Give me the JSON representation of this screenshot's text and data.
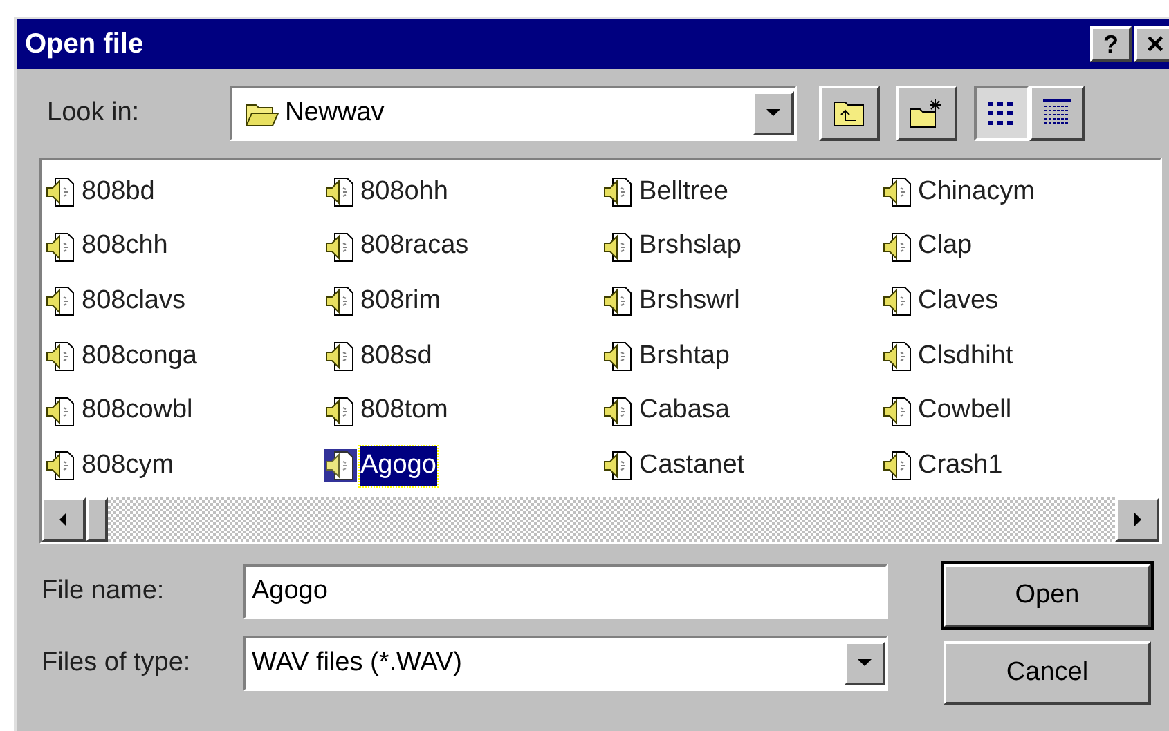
{
  "window": {
    "title": "Open file",
    "help_button": "?",
    "close_button": "×"
  },
  "look_in": {
    "label": "Look in:",
    "value": "Newwav"
  },
  "files": [
    {
      "name": "808bd",
      "selected": false
    },
    {
      "name": "808chh",
      "selected": false
    },
    {
      "name": "808clavs",
      "selected": false
    },
    {
      "name": "808conga",
      "selected": false
    },
    {
      "name": "808cowbl",
      "selected": false
    },
    {
      "name": "808cym",
      "selected": false
    },
    {
      "name": "808ohh",
      "selected": false
    },
    {
      "name": "808racas",
      "selected": false
    },
    {
      "name": "808rim",
      "selected": false
    },
    {
      "name": "808sd",
      "selected": false
    },
    {
      "name": "808tom",
      "selected": false
    },
    {
      "name": "Agogo",
      "selected": true
    },
    {
      "name": "Belltree",
      "selected": false
    },
    {
      "name": "Brshslap",
      "selected": false
    },
    {
      "name": "Brshswrl",
      "selected": false
    },
    {
      "name": "Brshtap",
      "selected": false
    },
    {
      "name": "Cabasa",
      "selected": false
    },
    {
      "name": "Castanet",
      "selected": false
    },
    {
      "name": "Chinacym",
      "selected": false
    },
    {
      "name": "Clap",
      "selected": false
    },
    {
      "name": "Claves",
      "selected": false
    },
    {
      "name": "Clsdhiht",
      "selected": false
    },
    {
      "name": "Cowbell",
      "selected": false
    },
    {
      "name": "Crash1",
      "selected": false
    }
  ],
  "file_name": {
    "label": "File name:",
    "value": "Agogo"
  },
  "file_type": {
    "label": "Files of type:",
    "value": "WAV files (*.WAV)"
  },
  "buttons": [
    {
      "label": "Open",
      "default": true
    },
    {
      "label": "Cancel",
      "default": false
    }
  ]
}
